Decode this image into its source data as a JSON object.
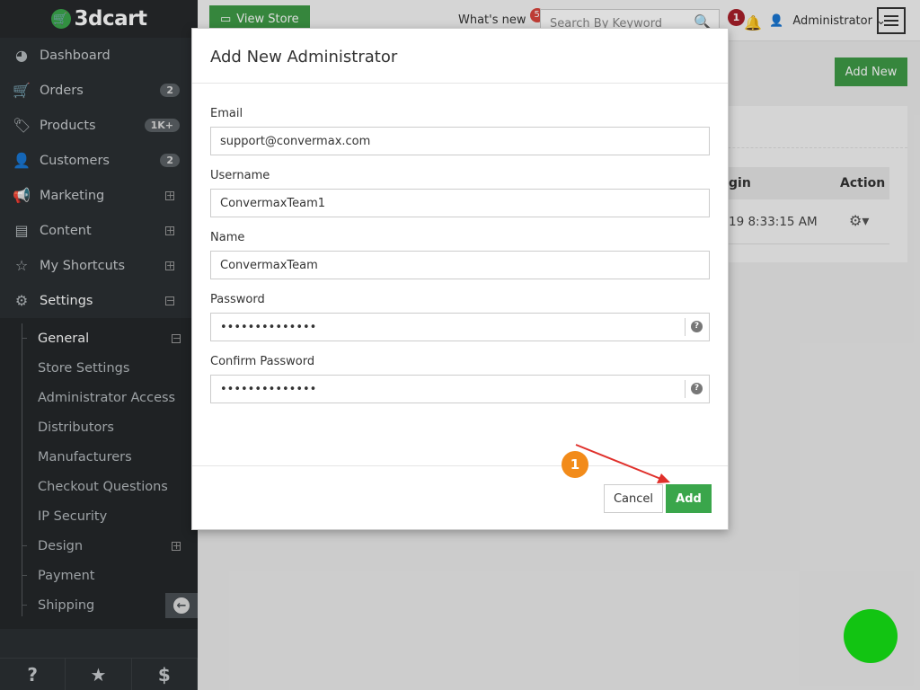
{
  "sidebar": {
    "logo": "3dcart",
    "items": [
      {
        "label": "Dashboard",
        "icon": "dashboard-icon"
      },
      {
        "label": "Orders",
        "icon": "cart-icon",
        "badge": "2"
      },
      {
        "label": "Products",
        "icon": "tags-icon",
        "badge": "1K+"
      },
      {
        "label": "Customers",
        "icon": "user-icon",
        "badge": "2"
      },
      {
        "label": "Marketing",
        "icon": "megaphone-icon"
      },
      {
        "label": "Content",
        "icon": "document-icon"
      },
      {
        "label": "My Shortcuts",
        "icon": "star-icon"
      },
      {
        "label": "Settings",
        "icon": "gears-icon"
      }
    ],
    "sub_items": [
      "General",
      "Store Settings",
      "Administrator Access",
      "Distributors",
      "Manufacturers",
      "Checkout Questions",
      "IP Security",
      "Design",
      "Payment",
      "Shipping"
    ],
    "bottom": {
      "help": "?",
      "star": "★",
      "dollar": "$"
    }
  },
  "header": {
    "view_store": "View Store",
    "whats_new": "What's new",
    "whats_new_badge": "5",
    "search_placeholder": "Search By Keyword",
    "notif_badge": "1",
    "admin_label": "Administrator"
  },
  "background": {
    "add_new": "Add New",
    "col_login": "gin",
    "col_action": "Action",
    "row_login": "19 8:33:15 AM"
  },
  "modal": {
    "title": "Add New Administrator",
    "fields": {
      "email": {
        "label": "Email",
        "value": "support@convermax.com"
      },
      "username": {
        "label": "Username",
        "value": "ConvermaxTeam1"
      },
      "name": {
        "label": "Name",
        "value": "ConvermaxTeam"
      },
      "password": {
        "label": "Password",
        "value": "••••••••••••••"
      },
      "confirm": {
        "label": "Confirm Password",
        "value": "••••••••••••••"
      }
    },
    "cancel": "Cancel",
    "add": "Add"
  },
  "annotation": {
    "step": "1",
    "color": "#f28b1a",
    "arrow_color": "#e0302b"
  },
  "colors": {
    "accent_green": "#3aa64b",
    "fab_green": "#12c412"
  }
}
